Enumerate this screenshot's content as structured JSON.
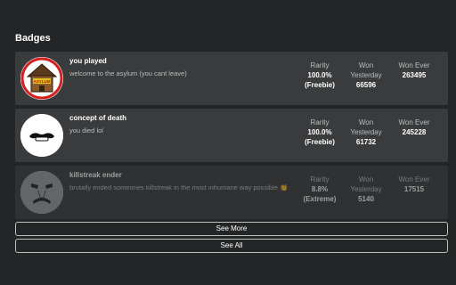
{
  "section": {
    "title": "Badges"
  },
  "badges": [
    {
      "name": "you played",
      "description": "welcome to the asylum (you cant leave)",
      "rarity_label": "Rarity",
      "rarity_value": "100.0%",
      "rarity_note": "(Freebie)",
      "won_yesterday_label_1": "Won",
      "won_yesterday_label_2": "Yesterday",
      "won_yesterday": "66596",
      "won_ever_label": "Won Ever",
      "won_ever": "263495",
      "sign_text": "ASYLUM"
    },
    {
      "name": "concept of death",
      "description": "you died lol",
      "rarity_label": "Rarity",
      "rarity_value": "100.0%",
      "rarity_note": "(Freebie)",
      "won_yesterday_label_1": "Won",
      "won_yesterday_label_2": "Yesterday",
      "won_yesterday": "61732",
      "won_ever_label": "Won Ever",
      "won_ever": "245228"
    },
    {
      "name": "killstreak ender",
      "description": "brutally ended someones killstreak in the most inhumane way possible 👏",
      "rarity_label": "Rarity",
      "rarity_value": "8.8%",
      "rarity_note": "(Extreme)",
      "won_yesterday_label_1": "Won",
      "won_yesterday_label_2": "Yesterday",
      "won_yesterday": "5140",
      "won_ever_label": "Won Ever",
      "won_ever": "17515"
    }
  ],
  "buttons": {
    "see_more": "See More",
    "see_all": "See All"
  },
  "colors": {
    "background": "#232527",
    "row": "#393b3d",
    "muted_text": "#bdbebe",
    "text": "#ffffff"
  }
}
